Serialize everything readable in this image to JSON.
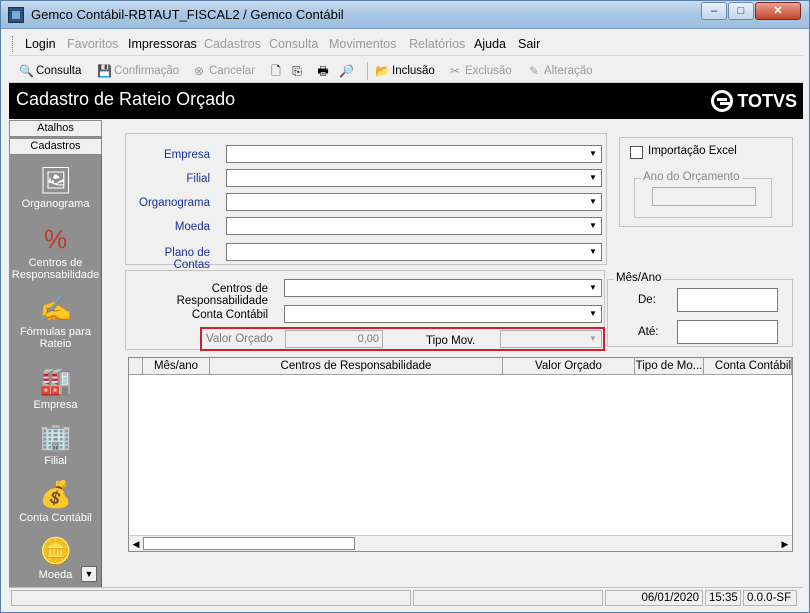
{
  "window": {
    "title": "Gemco Contábil-RBTAUT_FISCAL2 / Gemco Contábil",
    "min": "–",
    "max": "□",
    "close": "✕"
  },
  "menu": [
    {
      "label": "Login",
      "enabled": true
    },
    {
      "label": "Favoritos",
      "enabled": false
    },
    {
      "label": "Impressoras",
      "enabled": true
    },
    {
      "label": "Cadastros",
      "enabled": false
    },
    {
      "label": "Consulta",
      "enabled": false
    },
    {
      "label": "Movimentos",
      "enabled": false
    },
    {
      "label": "Relatórios",
      "enabled": false
    },
    {
      "label": "Ajuda",
      "enabled": true
    },
    {
      "label": "Sair",
      "enabled": true
    }
  ],
  "toolbar": {
    "consulta": "Consulta",
    "confirmacao": "Confirmação",
    "cancelar": "Cancelar",
    "inclusao": "Inclusão",
    "exclusao": "Exclusão",
    "alteracao": "Alteração"
  },
  "header": {
    "title": "Cadastro de Rateio Orçado",
    "brand": "TOTVS"
  },
  "sidebar": {
    "tab_atalhos": "Atalhos",
    "tab_cadastros": "Cadastros",
    "items": [
      {
        "label": "Organograma",
        "icon": "organogram-icon"
      },
      {
        "label": "Centros de Responsabilidade",
        "icon": "percent-money-icon"
      },
      {
        "label": "Fórmulas para Rateio",
        "icon": "formula-icon"
      },
      {
        "label": "Empresa",
        "icon": "factory-icon"
      },
      {
        "label": "Filial",
        "icon": "building-icon"
      },
      {
        "label": "Conta Contábil",
        "icon": "money-bag-icon"
      },
      {
        "label": "Moeda",
        "icon": "coins-icon"
      }
    ]
  },
  "form": {
    "empresa_label": "Empresa",
    "filial_label": "Filial",
    "organograma_label": "Organograma",
    "moeda_label": "Moeda",
    "plano_label": "Plano de Contas",
    "importacao_label": "Importação Excel",
    "ano_label": "Ano do Orçamento",
    "centros_label": "Centros de Responsabilidade",
    "conta_label": "Conta Contábil",
    "valor_label": "Valor Orçado",
    "valor_value": "0,00",
    "tipo_label": "Tipo Mov.",
    "mesano_label": "Mês/Ano",
    "de_label": "De:",
    "ate_label": "Até:"
  },
  "grid": {
    "columns": [
      "Mês/ano",
      "Centros de Responsabilidade",
      "Valor Orçado",
      "Tipo de Mo...",
      "Conta Contábil"
    ]
  },
  "status": {
    "date": "06/01/2020",
    "time": "15:35",
    "version": "0.0.0-SF"
  }
}
